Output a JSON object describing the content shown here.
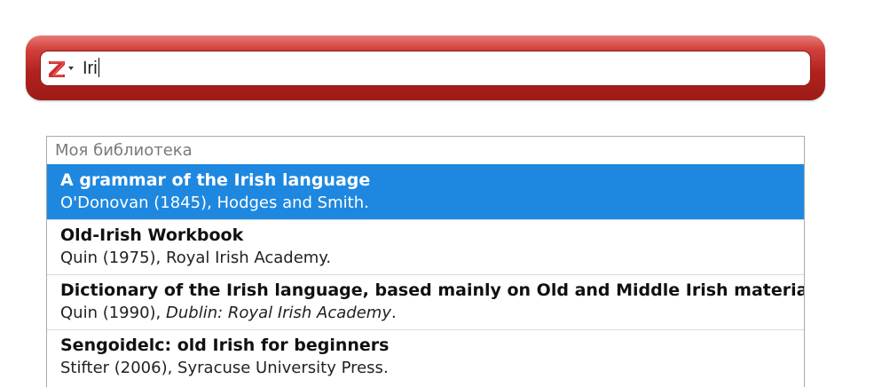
{
  "search": {
    "query": "Iri",
    "selector_icon": "zotero-z-icon",
    "brand_color": "#c0302c"
  },
  "results": {
    "header": "Моя библиотека",
    "selected_color": "#1e88e0",
    "items": [
      {
        "title": "A grammar of the Irish language",
        "meta_plain": "O'Donovan (1845), Hodges and Smith.",
        "meta_italic": "",
        "meta_suffix": ""
      },
      {
        "title": "Old-Irish Workbook",
        "meta_plain": "Quin (1975), Royal Irish Academy.",
        "meta_italic": "",
        "meta_suffix": ""
      },
      {
        "title": "Dictionary of the Irish language, based mainly on Old and Middle Irish materials",
        "meta_plain": "Quin (1990), ",
        "meta_italic": "Dublin: Royal Irish Academy",
        "meta_suffix": "."
      },
      {
        "title": "Sengoidelc: old Irish for beginners",
        "meta_plain": "Stifter (2006), Syracuse University Press.",
        "meta_italic": "",
        "meta_suffix": ""
      }
    ]
  }
}
